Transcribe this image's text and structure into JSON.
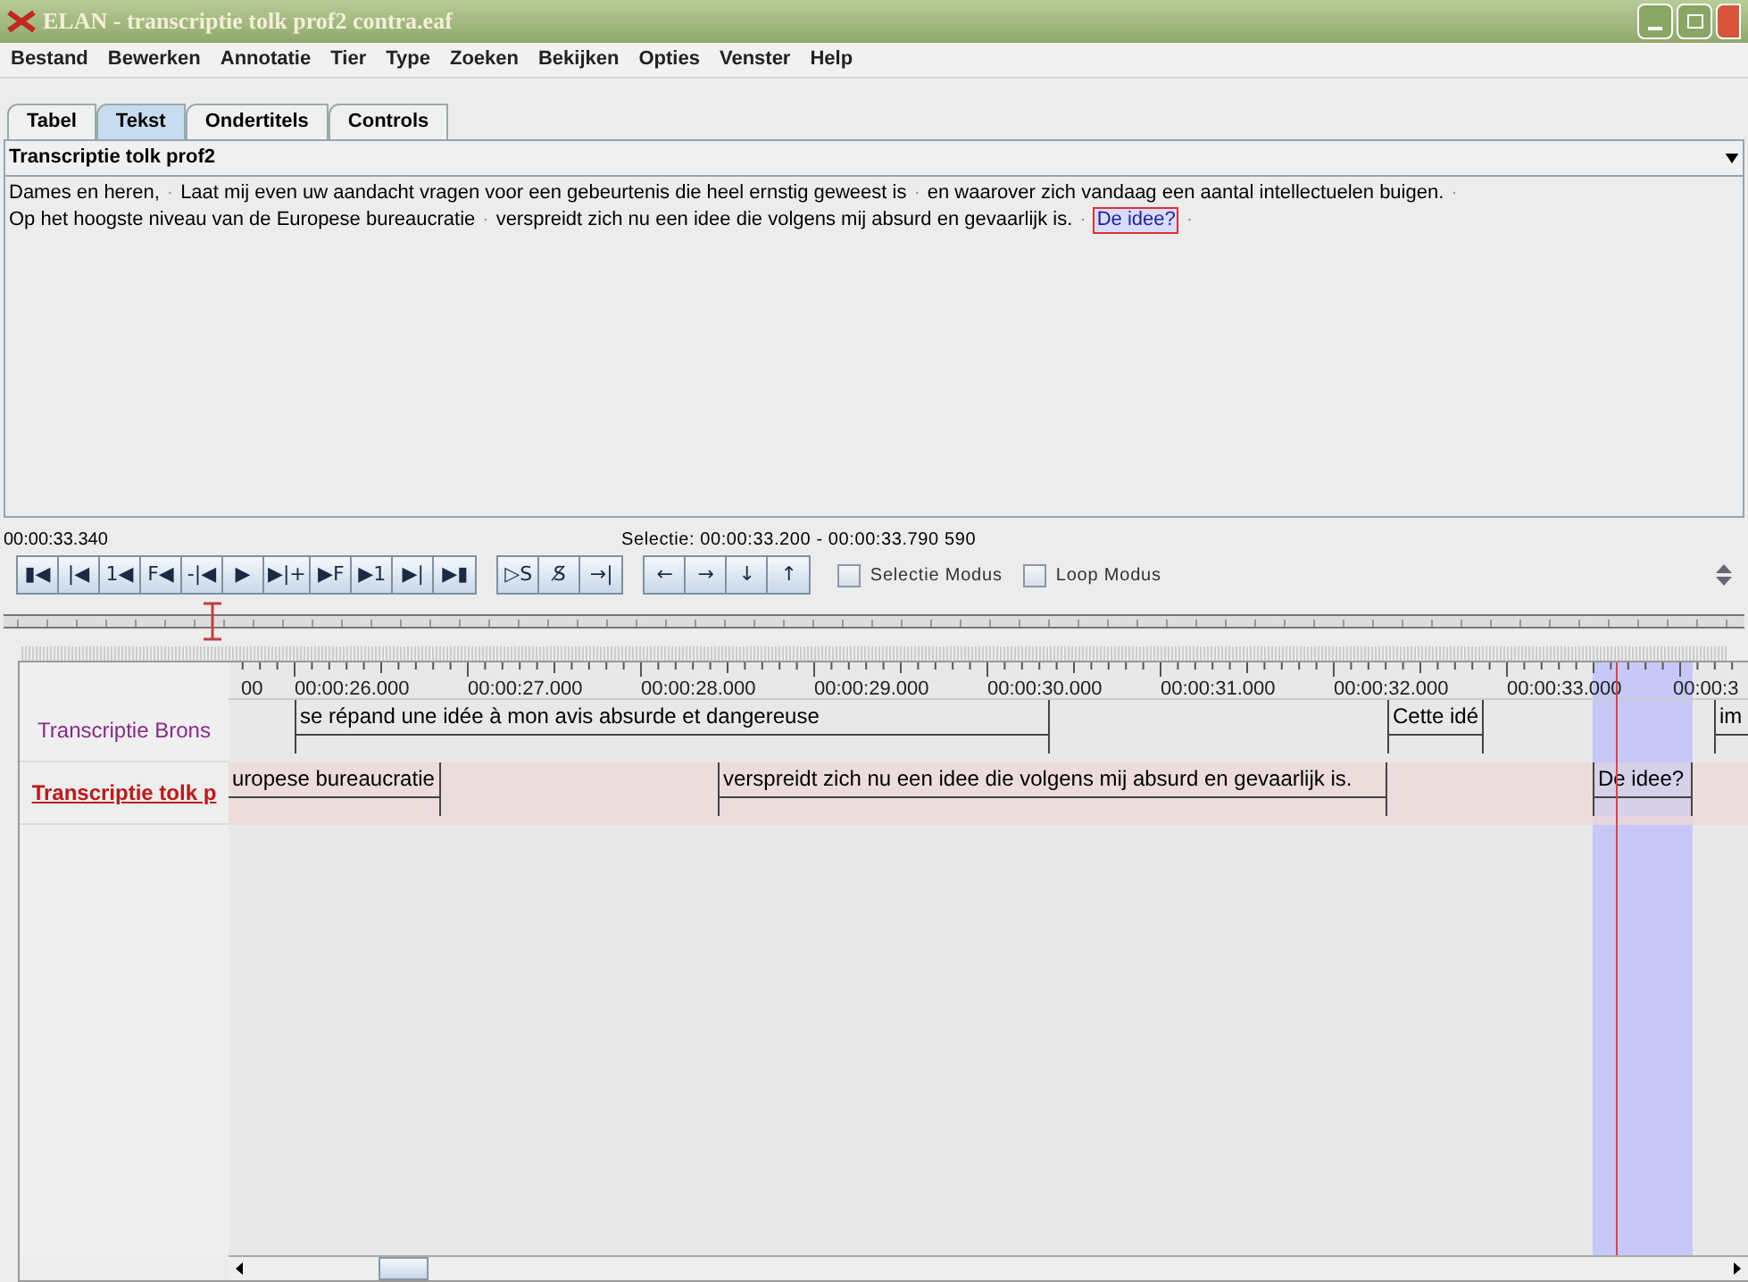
{
  "window": {
    "title": "ELAN - transcriptie tolk prof2 contra.eaf"
  },
  "menu": [
    "Bestand",
    "Bewerken",
    "Annotatie",
    "Tier",
    "Type",
    "Zoeken",
    "Bekijken",
    "Opties",
    "Venster",
    "Help"
  ],
  "tabs": [
    {
      "label": "Tabel",
      "selected": false
    },
    {
      "label": "Tekst",
      "selected": true
    },
    {
      "label": "Ondertitels",
      "selected": false
    },
    {
      "label": "Controls",
      "selected": false
    }
  ],
  "tier_select": {
    "value": "Transcriptie tolk prof2"
  },
  "text_view": {
    "separator": "·",
    "segments": [
      {
        "text": "Dames en heren,",
        "selected": false
      },
      {
        "text": "Laat mij even uw aandacht vragen voor een gebeurtenis die heel ernstig geweest is",
        "selected": false
      },
      {
        "text": "en waarover zich vandaag een aantal intellectuelen buigen.",
        "selected": false
      },
      {
        "text": "Op het hoogste niveau van de Europese bureaucratie",
        "selected": false
      },
      {
        "text": "verspreidt zich nu een idee die volgens mij absurd en gevaarlijk is.",
        "selected": false
      },
      {
        "text": "De idee?",
        "selected": true
      }
    ]
  },
  "media_time": "00:00:33.340",
  "selection_info": "Selectie: 00:00:33.200 - 00:00:33.790  590",
  "player_buttons": [
    [
      "▮◀",
      "|◀",
      "1◀",
      "F◀",
      "-|◀",
      "▶",
      "▶|+",
      "▶F",
      "▶1",
      "▶|",
      "▶▮"
    ],
    [
      "▷S",
      "S̸",
      "→|"
    ],
    [
      "←",
      "→",
      "↓",
      "↑"
    ]
  ],
  "options": [
    {
      "label": "Selectie Modus",
      "checked": false
    },
    {
      "label": "Loop Modus",
      "checked": false
    }
  ],
  "timeline_slider": {
    "level": 0.12
  },
  "ruler_labels": [
    "00",
    "00:00:26.000",
    "00:00:27.000",
    "00:00:28.000",
    "00:00:29.000",
    "00:00:30.000",
    "00:00:31.000",
    "00:00:32.000",
    "00:00:33.000",
    "00:00:3"
  ],
  "tiers": [
    {
      "name": "Transcriptie Brons",
      "active": false,
      "annotations": [
        {
          "text": "se répand une idée à mon avis absurde et dangereuse",
          "selected": false
        },
        {
          "text": "Cette idé",
          "selected": false
        },
        {
          "text": "im",
          "selected": false
        }
      ]
    },
    {
      "name": "Transcriptie tolk p",
      "active": true,
      "annotations": [
        {
          "text": "uropese bureaucratie",
          "selected": false
        },
        {
          "text": "verspreidt zich nu een idee die volgens mij absurd en gevaarlijk is.",
          "selected": false
        },
        {
          "text": "De idee?",
          "selected": true
        }
      ]
    }
  ]
}
